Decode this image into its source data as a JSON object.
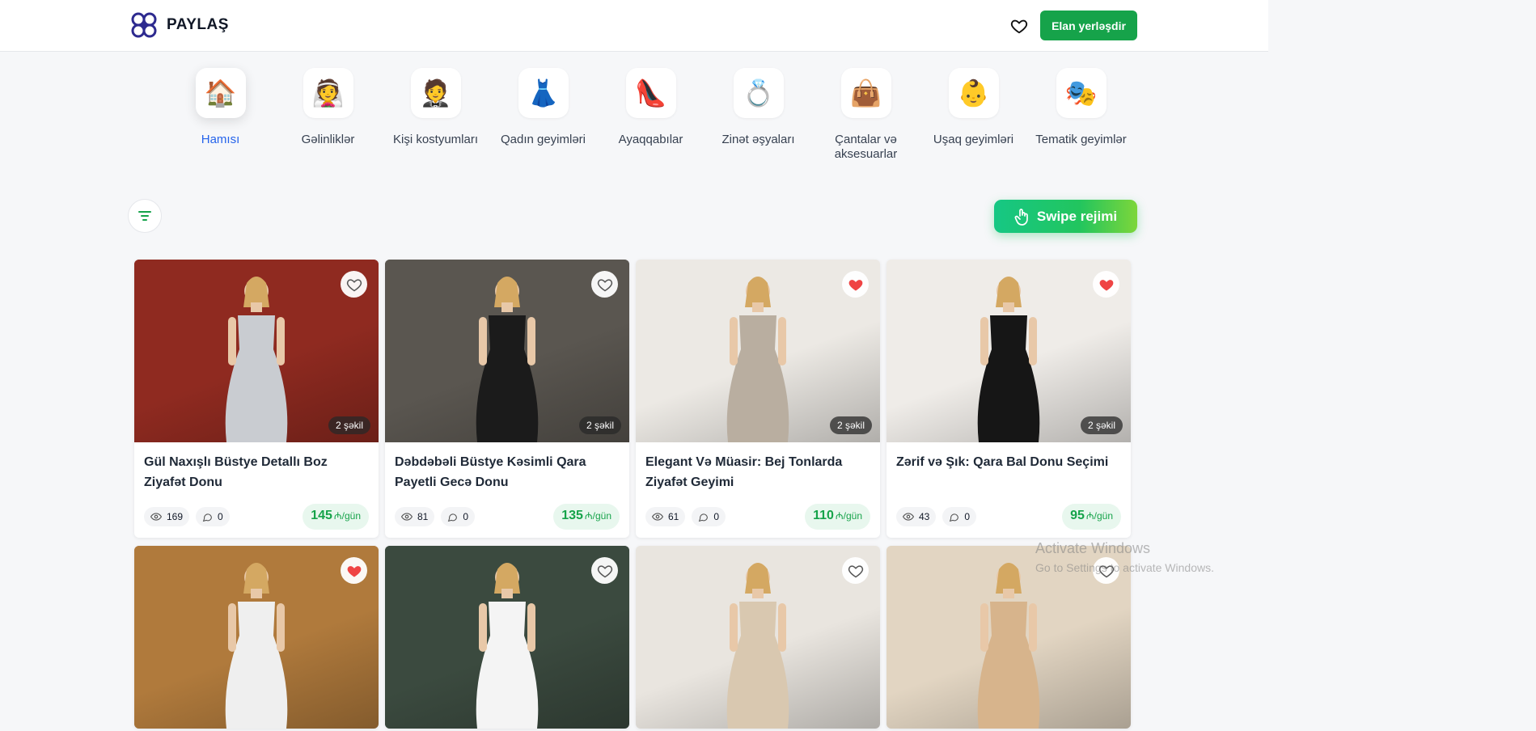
{
  "header": {
    "logo_text": "PAYLAŞ",
    "post_button": "Elan yerləşdir"
  },
  "categories": [
    {
      "label": "Hamısı",
      "icon": "house-icon",
      "emoji": "🏠",
      "active": true
    },
    {
      "label": "Gəlinliklər",
      "icon": "bride-icon",
      "emoji": "👰"
    },
    {
      "label": "Kişi kostyumları",
      "icon": "man-suit-icon",
      "emoji": "🤵"
    },
    {
      "label": "Qadın geyimləri",
      "icon": "dress-icon",
      "emoji": "👗"
    },
    {
      "label": "Ayaqqabılar",
      "icon": "heel-shoe-icon",
      "emoji": "👠"
    },
    {
      "label": "Zinət əşyaları",
      "icon": "ring-icon",
      "emoji": "💍"
    },
    {
      "label": "Çantalar və aksesuarlar",
      "icon": "handbag-icon",
      "emoji": "👜"
    },
    {
      "label": "Uşaq geyimləri",
      "icon": "baby-icon",
      "emoji": "👶"
    },
    {
      "label": "Tematik geyimlər",
      "icon": "theater-masks-icon",
      "emoji": "🎭"
    }
  ],
  "toolbar": {
    "swipe_label": "Swipe rejimi"
  },
  "listings": [
    {
      "title": "Gül Naxışlı Büstye Detallı Boz Ziyafət Donu",
      "photos": "2 şəkil",
      "views": "169",
      "comments": "0",
      "price": "145",
      "unit": "₼/gün",
      "favorited": false,
      "bg": "#8f2a20",
      "dress": "#c9ccd1"
    },
    {
      "title": "Dəbdəbəli Büstye Kəsimli Qara Payetli Gecə Donu",
      "photos": "2 şəkil",
      "views": "81",
      "comments": "0",
      "price": "135",
      "unit": "₼/gün",
      "favorited": false,
      "bg": "#5a5650",
      "dress": "#1b1b1b"
    },
    {
      "title": "Elegant Və Müasir: Bej Tonlarda Ziyafət Geyimi",
      "photos": "2 şəkil",
      "views": "61",
      "comments": "0",
      "price": "110",
      "unit": "₼/gün",
      "favorited": true,
      "bg": "#ece9e4",
      "dress": "#b9aea0"
    },
    {
      "title": "Zərif və Şık: Qara Bal Donu Seçimi",
      "photos": "2 şəkil",
      "views": "43",
      "comments": "0",
      "price": "95",
      "unit": "₼/gün",
      "favorited": true,
      "bg": "#efece8",
      "dress": "#161616"
    },
    {
      "title": "",
      "photos": "",
      "views": "",
      "comments": "",
      "price": "",
      "unit": "",
      "favorited": true,
      "bg": "#b07a3c",
      "dress": "#efefef"
    },
    {
      "title": "",
      "photos": "",
      "views": "",
      "comments": "",
      "price": "",
      "unit": "",
      "favorited": false,
      "bg": "#3b4a3f",
      "dress": "#f4f4f4"
    },
    {
      "title": "",
      "photos": "",
      "views": "",
      "comments": "",
      "price": "",
      "unit": "",
      "favorited": false,
      "bg": "#e9e5df",
      "dress": "#d9c8b0"
    },
    {
      "title": "",
      "photos": "",
      "views": "",
      "comments": "",
      "price": "",
      "unit": "",
      "favorited": false,
      "bg": "#e2d5c2",
      "dress": "#d7b48c"
    }
  ],
  "watermark": {
    "line1": "Activate Windows",
    "line2": "Go to Settings to activate Windows."
  },
  "colors": {
    "accent_green": "#16a34a",
    "active_category": "#2563eb",
    "heart_red": "#ef4444"
  }
}
